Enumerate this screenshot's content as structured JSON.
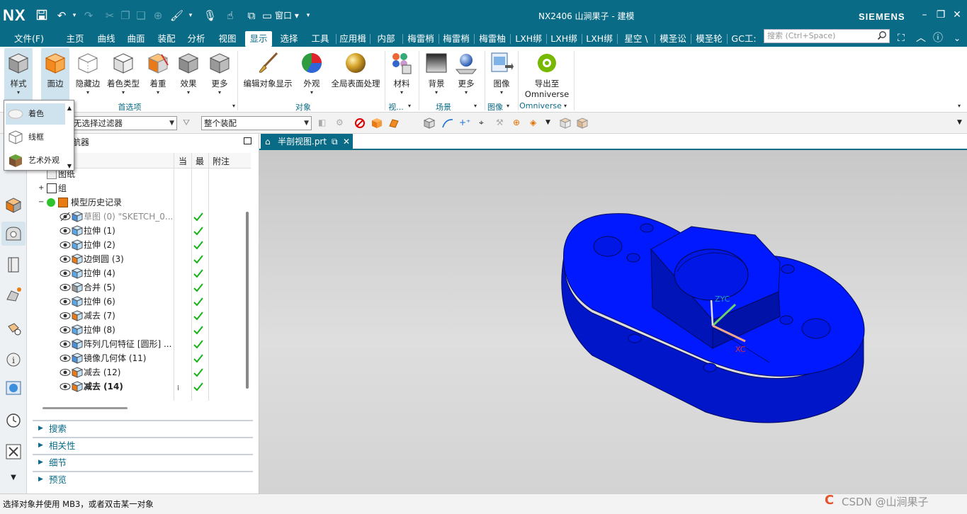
{
  "titlebar": {
    "logo": "NX",
    "window_menu": "窗口",
    "title": "NX2406 山涧果子 - 建模",
    "brand": "SIEMENS"
  },
  "menubar": {
    "items": [
      "文件(F)",
      "主页",
      "曲线",
      "曲面",
      "装配",
      "分析",
      "视图",
      "显示",
      "选择",
      "工具",
      "应用楫",
      "内部",
      "梅雷梢",
      "梅雷梢",
      "梅雷柚",
      "LXH绑",
      "LXH绑",
      "LXH绑",
      "星空 \\",
      "模圣讼",
      "模圣轮",
      "GC工:"
    ],
    "active": "显示",
    "search_placeholder": "搜索 (Ctrl+Space)"
  },
  "ribbon": {
    "buttons": {
      "style": "样式",
      "edge": "面边",
      "hidden_edge": "隐藏边",
      "shade_type": "着色类型",
      "recolor": "着重",
      "effect": "效果",
      "more1": "更多",
      "edit_display": "编辑对象显示",
      "appearance": "外观",
      "global_surface": "全局表面处理",
      "material": "材料",
      "background": "背景",
      "more2": "更多",
      "image": "图像",
      "export_line1": "导出至",
      "export_line2": "Omniverse"
    },
    "groups": {
      "preferences": "首选项",
      "object": "对象",
      "view": "视...",
      "scene": "场景",
      "image": "图像",
      "omniverse": "Omniverse"
    }
  },
  "styles_menu": {
    "options": [
      "着色",
      "线框",
      "艺术外观"
    ],
    "selected": "着色"
  },
  "selection_bar": {
    "filter": "无选择过滤器",
    "scope": "整个装配"
  },
  "navigator": {
    "title": "部件导航器",
    "title_visible": "航器",
    "columns": {
      "current": "当",
      "latest": "最",
      "note": "附注"
    },
    "rows": [
      {
        "label": "图纸",
        "type": "drawing"
      },
      {
        "label": "组",
        "type": "group"
      },
      {
        "label": "模型历史记录",
        "type": "history"
      },
      {
        "label": "草图 (0) \"SKETCH_0...",
        "type": "sketch",
        "dim": true
      },
      {
        "label": "拉伸 (1)",
        "type": "extrude"
      },
      {
        "label": "拉伸 (2)",
        "type": "extrude"
      },
      {
        "label": "边倒圆 (3)",
        "type": "blend"
      },
      {
        "label": "拉伸 (4)",
        "type": "extrude"
      },
      {
        "label": "合并 (5)",
        "type": "unite"
      },
      {
        "label": "拉伸 (6)",
        "type": "extrude"
      },
      {
        "label": "减去 (7)",
        "type": "subtract"
      },
      {
        "label": "拉伸 (8)",
        "type": "extrude"
      },
      {
        "label": "阵列几何特征 [圆形] ...",
        "type": "pattern"
      },
      {
        "label": "镜像几何体 (11)",
        "type": "mirror"
      },
      {
        "label": "减去 (12)",
        "type": "subtract"
      },
      {
        "label": "减去 (14)",
        "type": "subtract",
        "bold": true
      }
    ],
    "panels": [
      "搜索",
      "相关性",
      "细节",
      "预览"
    ]
  },
  "tab": {
    "label": "半剖视图.prt"
  },
  "viewport": {
    "axis_labels": {
      "zc": "ZYC",
      "xc": "XC"
    },
    "model_color": "#0019ff"
  },
  "status": {
    "text": "选择对象并使用 MB3，或者双击某一对象"
  },
  "watermark": {
    "text": "CSDN @山涧果子"
  }
}
